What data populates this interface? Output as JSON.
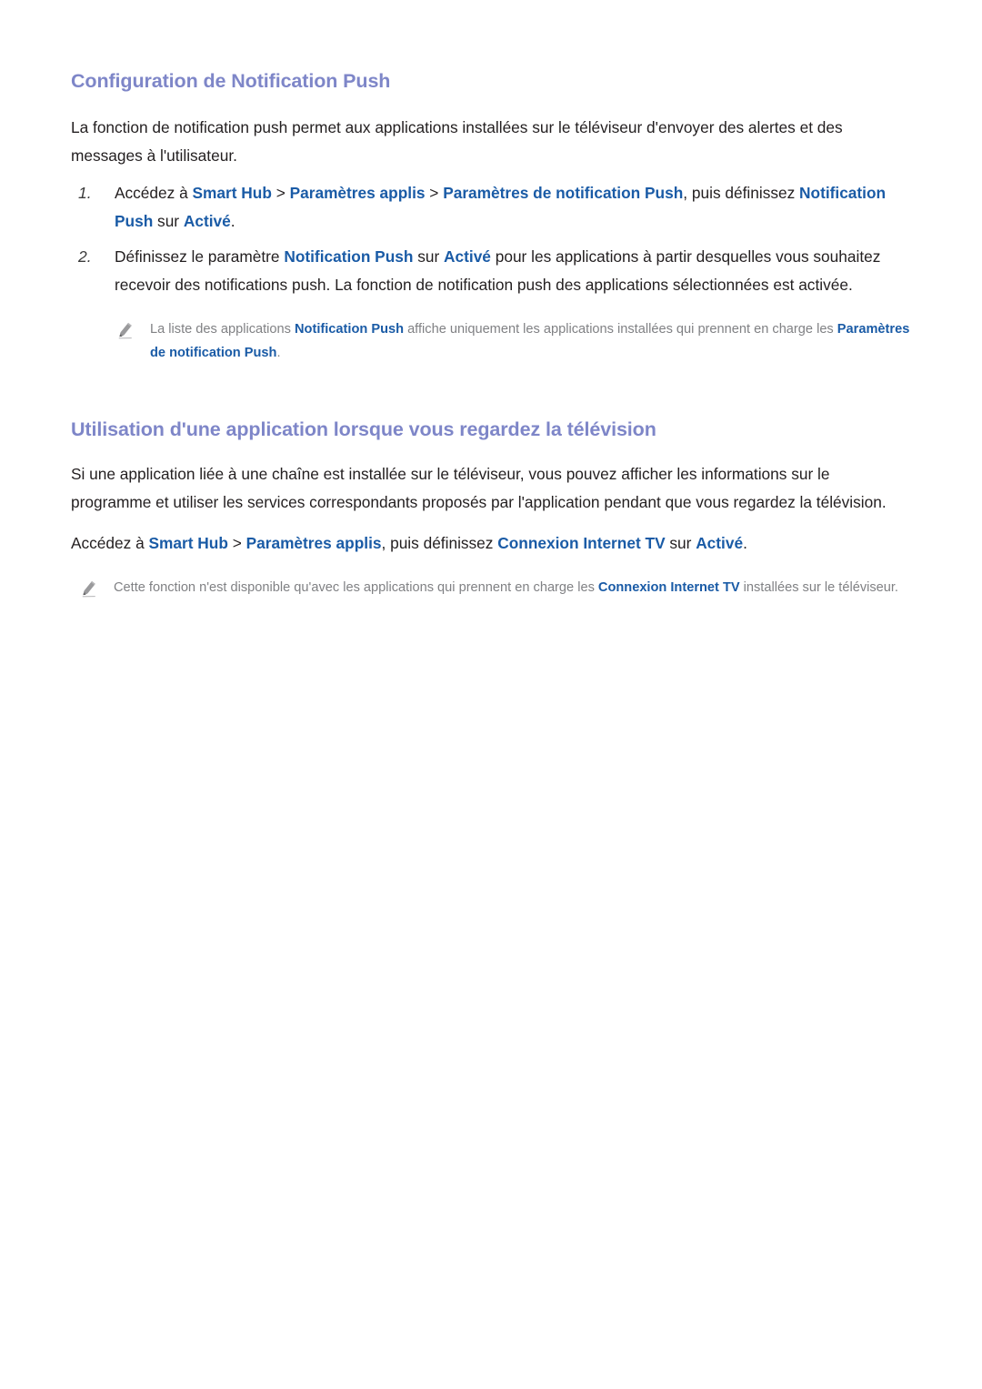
{
  "document": {
    "language": "fr",
    "page_background": "#ffffff",
    "heading_color": "#7e86c8",
    "body_color": "#231f20",
    "link_bold_color": "#1a5ba6",
    "note_color": "#808184"
  },
  "sections": [
    {
      "heading": "Configuration de Notification Push",
      "intro": "La fonction de notification push permet aux applications installées sur le téléviseur d'envoyer des alertes et des messages à l'utilisateur.",
      "steps": [
        {
          "number": "1.",
          "parts": [
            {
              "text": "Accédez à ",
              "style": "plain"
            },
            {
              "text": "Smart Hub",
              "style": "bold-blue"
            },
            {
              "text": " > ",
              "style": "separator"
            },
            {
              "text": "Paramètres applis",
              "style": "bold-blue"
            },
            {
              "text": " > ",
              "style": "separator"
            },
            {
              "text": "Paramètres de notification Push",
              "style": "bold-blue"
            },
            {
              "text": ", puis définissez ",
              "style": "plain"
            },
            {
              "text": "Notification Push",
              "style": "bold-blue"
            },
            {
              "text": " sur ",
              "style": "plain"
            },
            {
              "text": "Activé",
              "style": "bold-blue"
            },
            {
              "text": ".",
              "style": "plain"
            }
          ]
        },
        {
          "number": "2.",
          "parts": [
            {
              "text": "Définissez le paramètre ",
              "style": "plain"
            },
            {
              "text": "Notification Push",
              "style": "bold-blue"
            },
            {
              "text": " sur ",
              "style": "plain"
            },
            {
              "text": "Activé",
              "style": "bold-blue"
            },
            {
              "text": " pour les applications à partir desquelles vous souhaitez recevoir des notifications push. La fonction de notification push des applications sélectionnées est activée.",
              "style": "plain"
            }
          ]
        }
      ],
      "note": {
        "icon": "pencil-icon",
        "parts": [
          {
            "text": "La liste des applications ",
            "style": "plain"
          },
          {
            "text": "Notification Push",
            "style": "bold-blue"
          },
          {
            "text": " affiche uniquement les applications installées qui prennent en charge les ",
            "style": "plain"
          },
          {
            "text": "Paramètres de notification Push",
            "style": "bold-blue"
          },
          {
            "text": ".",
            "style": "plain"
          }
        ]
      }
    },
    {
      "heading": "Utilisation d'une application lorsque vous regardez la télévision",
      "intro": "Si une application liée à une chaîne est installée sur le téléviseur, vous pouvez afficher les informations sur le programme et utiliser les services correspondants proposés par l'application pendant que vous regardez la télévision.",
      "goto_line": {
        "parts": [
          {
            "text": "Accédez à ",
            "style": "plain"
          },
          {
            "text": "Smart Hub",
            "style": "bold-blue"
          },
          {
            "text": " > ",
            "style": "separator"
          },
          {
            "text": "Paramètres applis",
            "style": "bold-blue"
          },
          {
            "text": ", puis définissez ",
            "style": "plain"
          },
          {
            "text": "Connexion Internet TV",
            "style": "bold-blue"
          },
          {
            "text": " sur ",
            "style": "plain"
          },
          {
            "text": "Activé",
            "style": "bold-blue"
          },
          {
            "text": ".",
            "style": "plain"
          }
        ]
      },
      "note": {
        "icon": "pencil-icon",
        "parts": [
          {
            "text": "Cette fonction n'est disponible qu'avec les applications qui prennent en charge les ",
            "style": "plain"
          },
          {
            "text": "Connexion Internet TV",
            "style": "bold-blue"
          },
          {
            "text": " installées sur le téléviseur.",
            "style": "plain"
          }
        ]
      }
    }
  ]
}
